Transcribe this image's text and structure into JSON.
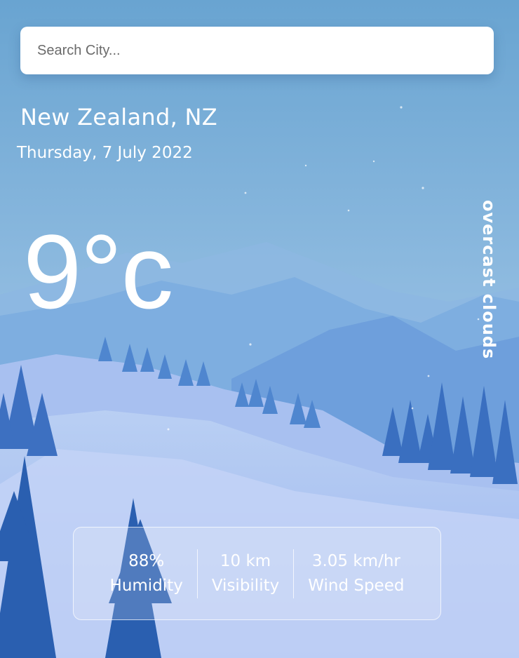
{
  "search": {
    "placeholder": "Search City..."
  },
  "location": "New Zealand, NZ",
  "date": "Thursday, 7 July 2022",
  "temperature": "9°c",
  "condition": "overcast clouds",
  "stats": {
    "humidity": {
      "value": "88%",
      "label": "Humidity"
    },
    "visibility": {
      "value": "10 km",
      "label": "Visibility"
    },
    "wind": {
      "value": "3.05 km/hr",
      "label": "Wind Speed"
    }
  },
  "colors": {
    "sky_top": "#6aa5d2",
    "sky_bottom": "#a9c5ec",
    "snow": "#c9d8f6",
    "tree": "#2f65b4"
  }
}
